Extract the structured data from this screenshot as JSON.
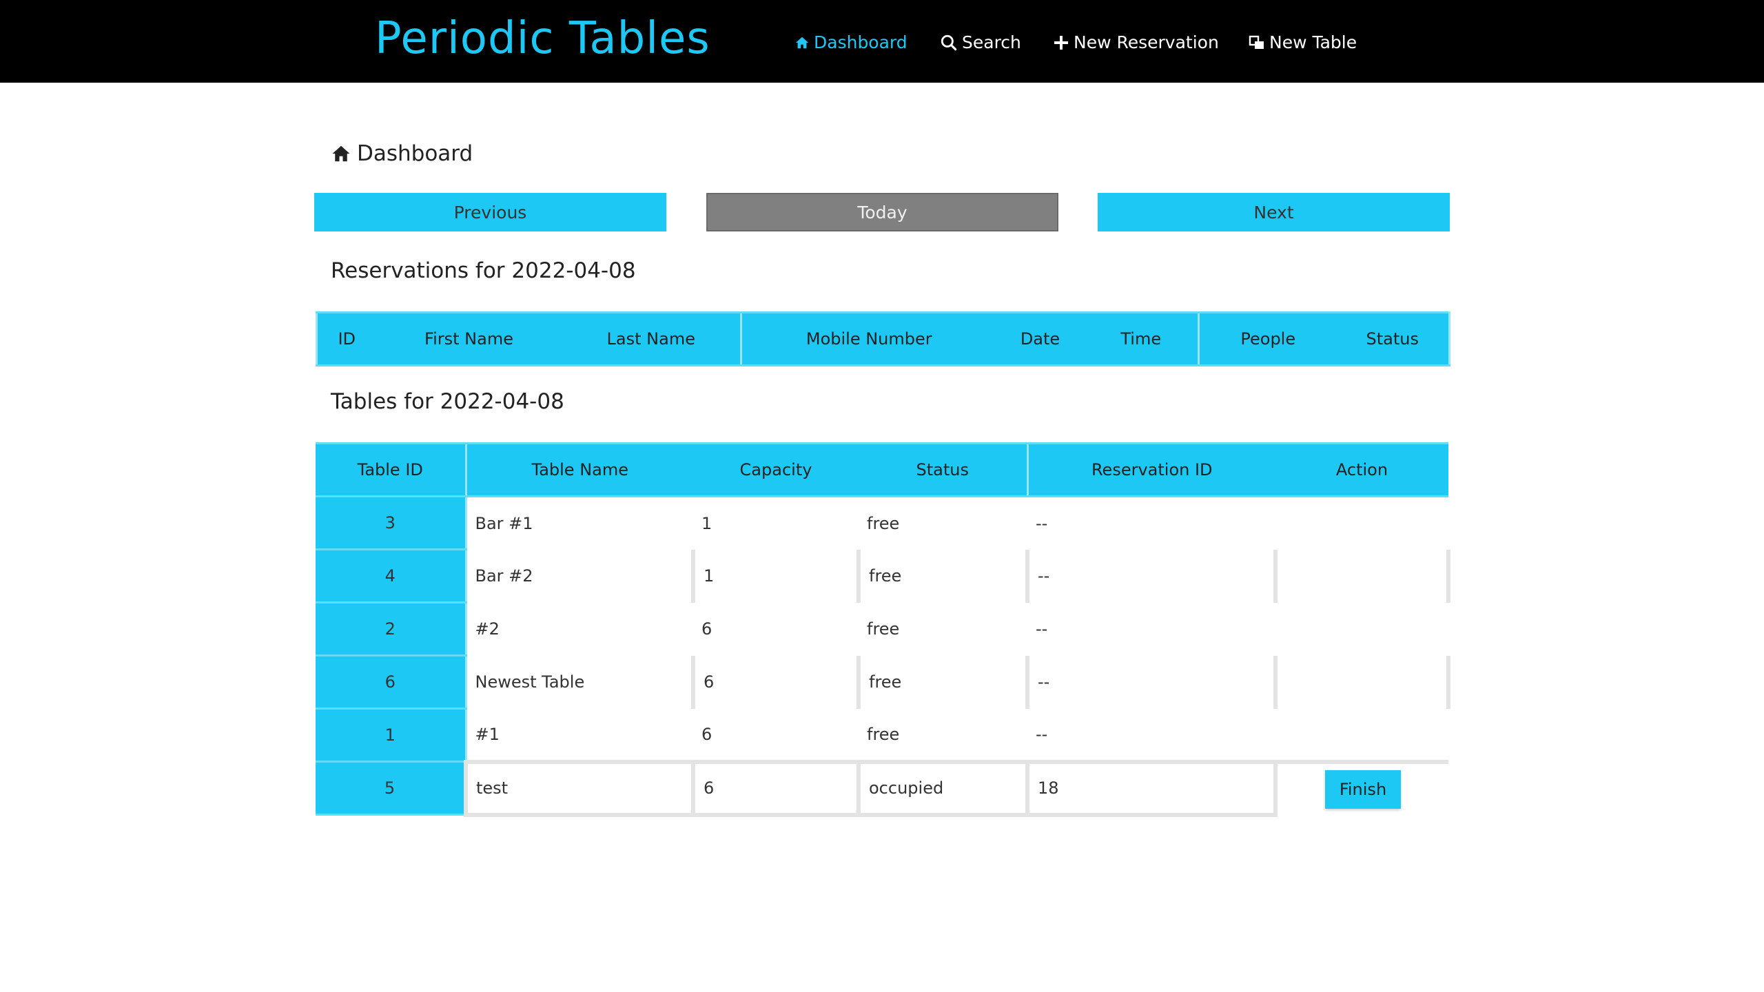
{
  "app": {
    "brand": "Periodic Tables"
  },
  "nav": {
    "dashboard": "Dashboard",
    "search": "Search",
    "new_reservation": "New Reservation",
    "new_table": "New Table"
  },
  "page": {
    "heading": "Dashboard"
  },
  "date_nav": {
    "previous": "Previous",
    "today": "Today",
    "next": "Next"
  },
  "reservations": {
    "title": "Reservations for 2022-04-08",
    "headers": [
      "ID",
      "First Name",
      "Last Name",
      "Mobile Number",
      "Date",
      "Time",
      "People",
      "Status"
    ],
    "rows": []
  },
  "tables": {
    "title": "Tables for 2022-04-08",
    "headers": [
      "Table ID",
      "Table Name",
      "Capacity",
      "Status",
      "Reservation ID",
      "Action"
    ],
    "rows": [
      {
        "id": "3",
        "name": "Bar #1",
        "capacity": "1",
        "status": "free",
        "reservation_id": "--",
        "action": ""
      },
      {
        "id": "4",
        "name": "Bar #2",
        "capacity": "1",
        "status": "free",
        "reservation_id": "--",
        "action": ""
      },
      {
        "id": "2",
        "name": "#2",
        "capacity": "6",
        "status": "free",
        "reservation_id": "--",
        "action": ""
      },
      {
        "id": "6",
        "name": "Newest Table",
        "capacity": "6",
        "status": "free",
        "reservation_id": "--",
        "action": ""
      },
      {
        "id": "1",
        "name": "#1",
        "capacity": "6",
        "status": "free",
        "reservation_id": "--",
        "action": ""
      },
      {
        "id": "5",
        "name": "test",
        "capacity": "6",
        "status": "occupied",
        "reservation_id": "18",
        "action": "Finish"
      }
    ]
  },
  "colors": {
    "accent": "#1ec8f5",
    "navbar": "#000000",
    "today_button": "#808080"
  },
  "icons": {
    "dashboard": "home-icon",
    "search": "search-icon",
    "new_reservation": "plus-icon",
    "new_table": "table-icon"
  }
}
